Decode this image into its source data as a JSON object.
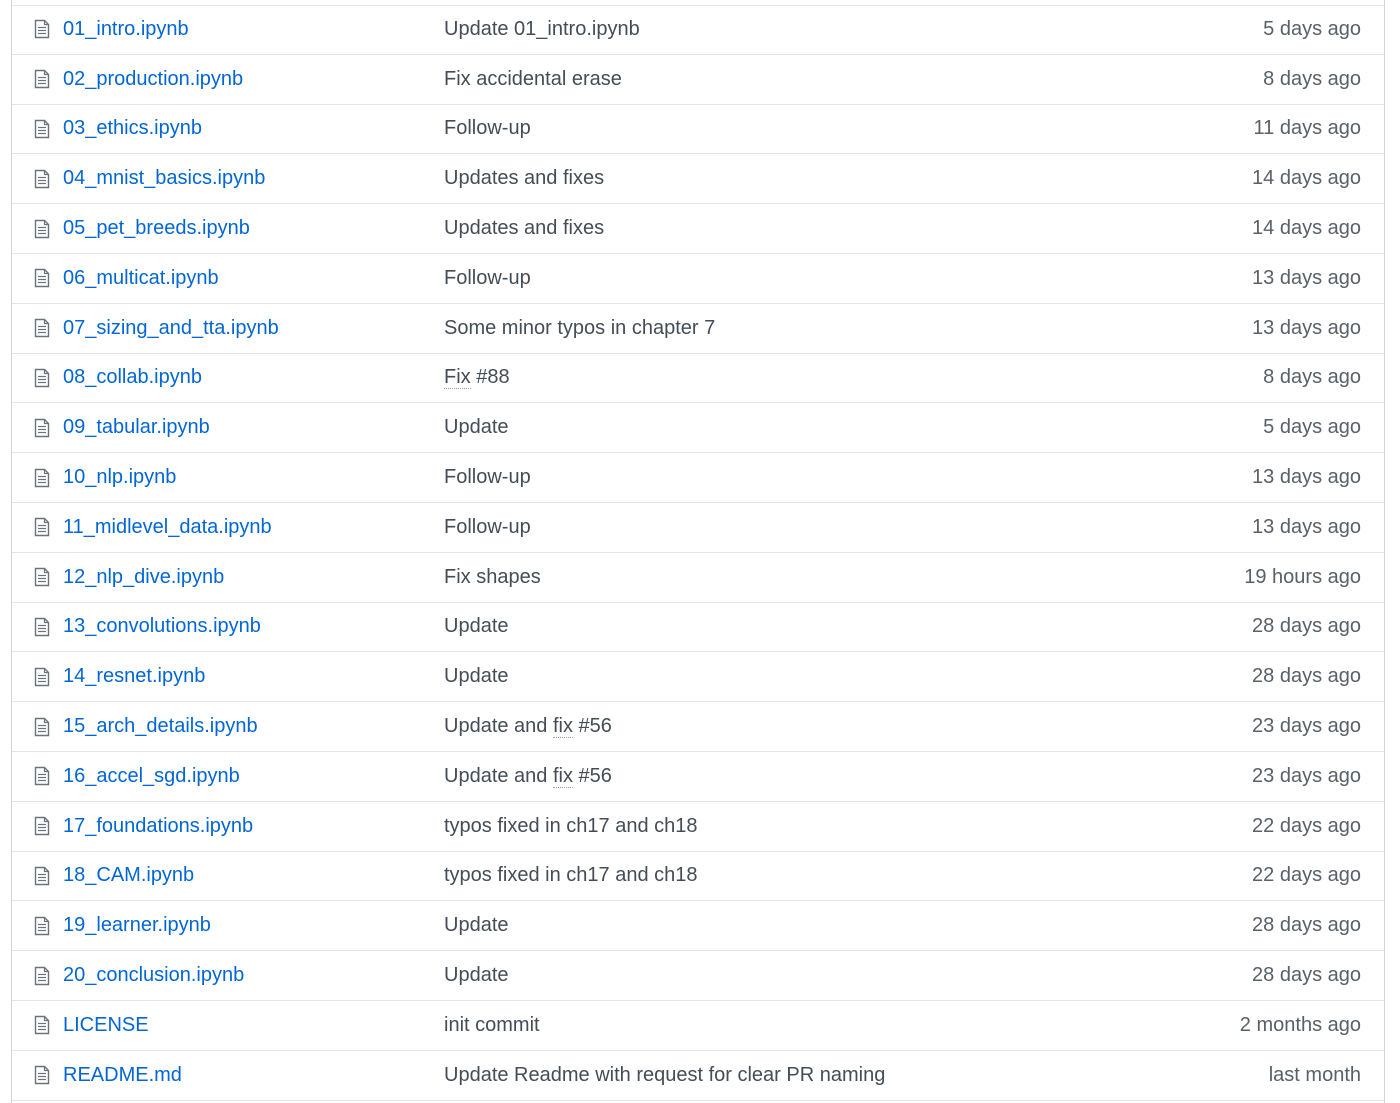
{
  "files": [
    {
      "name": "01_intro.ipynb",
      "message": [
        "Update 01_intro.ipynb"
      ],
      "age": "5 days ago"
    },
    {
      "name": "02_production.ipynb",
      "message": [
        "Fix accidental erase"
      ],
      "age": "8 days ago"
    },
    {
      "name": "03_ethics.ipynb",
      "message": [
        "Follow-up"
      ],
      "age": "11 days ago"
    },
    {
      "name": "04_mnist_basics.ipynb",
      "message": [
        "Updates and fixes"
      ],
      "age": "14 days ago"
    },
    {
      "name": "05_pet_breeds.ipynb",
      "message": [
        "Updates and fixes"
      ],
      "age": "14 days ago"
    },
    {
      "name": "06_multicat.ipynb",
      "message": [
        "Follow-up"
      ],
      "age": "13 days ago"
    },
    {
      "name": "07_sizing_and_tta.ipynb",
      "message": [
        "Some minor typos in chapter 7"
      ],
      "age": "13 days ago"
    },
    {
      "name": "08_collab.ipynb",
      "message": [
        "",
        "Fix",
        " #88"
      ],
      "age": "8 days ago"
    },
    {
      "name": "09_tabular.ipynb",
      "message": [
        "Update"
      ],
      "age": "5 days ago"
    },
    {
      "name": "10_nlp.ipynb",
      "message": [
        "Follow-up"
      ],
      "age": "13 days ago"
    },
    {
      "name": "11_midlevel_data.ipynb",
      "message": [
        "Follow-up"
      ],
      "age": "13 days ago"
    },
    {
      "name": "12_nlp_dive.ipynb",
      "message": [
        "Fix shapes"
      ],
      "age": "19 hours ago"
    },
    {
      "name": "13_convolutions.ipynb",
      "message": [
        "Update"
      ],
      "age": "28 days ago"
    },
    {
      "name": "14_resnet.ipynb",
      "message": [
        "Update"
      ],
      "age": "28 days ago"
    },
    {
      "name": "15_arch_details.ipynb",
      "message": [
        "Update and ",
        "fix",
        " #56"
      ],
      "age": "23 days ago"
    },
    {
      "name": "16_accel_sgd.ipynb",
      "message": [
        "Update and ",
        "fix",
        " #56"
      ],
      "age": "23 days ago"
    },
    {
      "name": "17_foundations.ipynb",
      "message": [
        "typos fixed in ch17 and ch18"
      ],
      "age": "22 days ago"
    },
    {
      "name": "18_CAM.ipynb",
      "message": [
        "typos fixed in ch17 and ch18"
      ],
      "age": "22 days ago"
    },
    {
      "name": "19_learner.ipynb",
      "message": [
        "Update"
      ],
      "age": "28 days ago"
    },
    {
      "name": "20_conclusion.ipynb",
      "message": [
        "Update"
      ],
      "age": "28 days ago"
    },
    {
      "name": "LICENSE",
      "message": [
        "init commit"
      ],
      "age": "2 months ago"
    },
    {
      "name": "README.md",
      "message": [
        "Update Readme with request for clear PR naming"
      ],
      "age": "last month"
    }
  ],
  "icons": {
    "file": "file-icon"
  },
  "colors": {
    "link": "#0366d6",
    "border": "#e1e4e8",
    "text": "#444d56",
    "muted": "#586069"
  }
}
